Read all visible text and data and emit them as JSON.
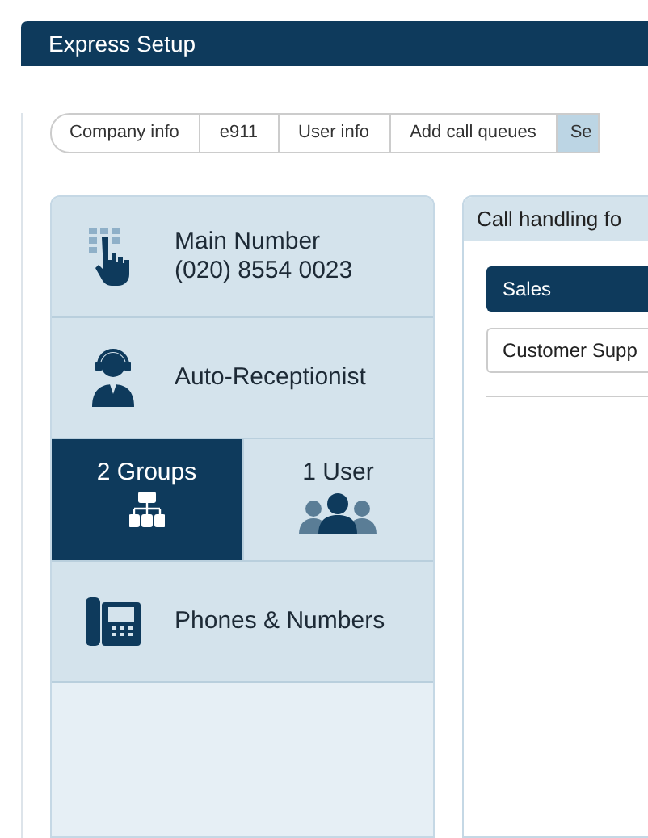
{
  "window": {
    "title": "Express Setup"
  },
  "steps": [
    {
      "label": "Company info",
      "selected": false
    },
    {
      "label": "e911",
      "selected": false
    },
    {
      "label": "User info",
      "selected": false
    },
    {
      "label": "Add call queues",
      "selected": false
    },
    {
      "label": "Se",
      "selected": true
    }
  ],
  "sidebar": {
    "items": [
      {
        "kind": "keypad",
        "title": "Main Number",
        "subtitle": "(020) 8554 0023"
      },
      {
        "kind": "headset",
        "title": "Auto-Receptionist"
      },
      {
        "kind": "split",
        "tiles": [
          {
            "kind": "groups",
            "label": "2 Groups",
            "selected": true
          },
          {
            "kind": "users",
            "label": "1 User",
            "selected": false
          }
        ]
      },
      {
        "kind": "phone",
        "title": "Phones & Numbers"
      }
    ]
  },
  "panel": {
    "title": "Call handling fo",
    "groups": [
      {
        "label": "Sales",
        "selected": true
      },
      {
        "label": "Customer Supp",
        "selected": false
      }
    ]
  }
}
